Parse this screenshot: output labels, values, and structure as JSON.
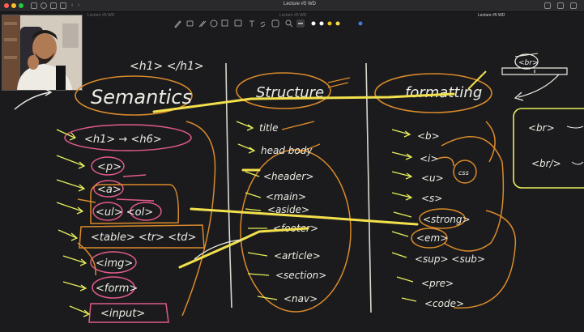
{
  "window": {
    "title": "Lecture #5 WD",
    "tabs": [
      "Lecture #5 WD",
      "Lecture #5 WD",
      "Lecture #5 WD"
    ],
    "active_tab": 2
  },
  "toolbar": {
    "tools": [
      "pen-icon",
      "eraser-icon",
      "highlighter-icon",
      "lasso-icon",
      "shapes-icon",
      "image-icon",
      "text-icon",
      "link-icon",
      "sticker-icon",
      "zoom-icon"
    ],
    "pen_colors": [
      "#ffffff",
      "#ffffff",
      "#f0c419",
      "#f2e04c",
      "#3a7fe0"
    ]
  },
  "board": {
    "heading_tags": "<h1>   </h1>",
    "columns": {
      "semantics": {
        "title": "Semantics",
        "items": [
          "<h1> → <h6>",
          "<p>",
          "<a>",
          "<ul>   <ol>",
          "<table>  <tr>   <td>",
          "<img>",
          "<form>",
          "<input>"
        ]
      },
      "structure": {
        "title": "Structure",
        "items": [
          "title",
          "head  body",
          "<header>",
          "<main>",
          "<aside>",
          "<footer>",
          "<article>",
          "<section>",
          "<nav>"
        ]
      },
      "formatting": {
        "title": "formatting",
        "items": [
          "<b>",
          "<i>",
          "<u>",
          "<s>",
          "<strong>",
          "<em>",
          "<sup>   <sub>",
          "<pre>",
          "<code>"
        ],
        "css_note": "css"
      }
    },
    "side_notes": {
      "br_tag": "<br>",
      "br_box_lines": [
        "<br>",
        "<br/>"
      ]
    }
  }
}
